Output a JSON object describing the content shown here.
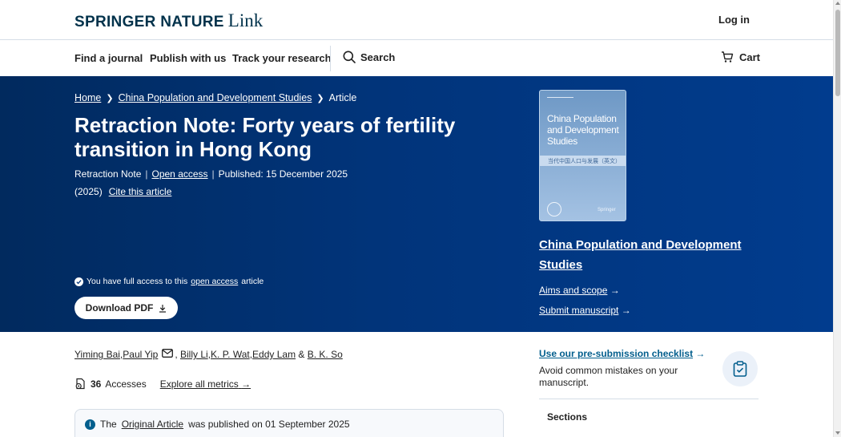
{
  "header": {
    "logo_brand": "SPRINGER NATURE",
    "logo_link": "Link",
    "login": "Log in"
  },
  "nav": {
    "find_journal": "Find a journal",
    "publish": "Publish with us",
    "track": "Track your research",
    "search": "Search",
    "cart": "Cart"
  },
  "breadcrumb": {
    "home": "Home",
    "journal": "China Population and Development Studies",
    "current": "Article"
  },
  "article": {
    "title": "Retraction Note: Forty years of fertility transition in Hong Kong",
    "type": "Retraction Note",
    "open_access": "Open access",
    "published": "Published: 15 December 2025",
    "year": "(2025)",
    "cite": "Cite this article",
    "access_prefix": "You have full access to this",
    "access_link": "open access",
    "access_suffix": "article",
    "download": "Download PDF"
  },
  "journal": {
    "cover_title": "China Population and Development Studies",
    "cover_chinese": "当代中国人口与发展（英文）",
    "cover_publisher": "Springer",
    "title": "China Population and Development Studies",
    "aims": "Aims and scope",
    "submit": "Submit manuscript"
  },
  "authors": [
    {
      "name": "Yiming Bai",
      "sep": ", "
    },
    {
      "name": "Paul Yip",
      "sep": ""
    },
    {
      "name": "Billy Li",
      "sep": ", "
    },
    {
      "name": "K. P. Wat",
      "sep": ", "
    },
    {
      "name": "Eddy Lam",
      "sep": " & "
    },
    {
      "name": "B. K. So",
      "sep": ""
    }
  ],
  "metrics": {
    "accesses": "36",
    "accesses_label": "Accesses",
    "explore": "Explore all metrics"
  },
  "notice": {
    "prefix": "The",
    "link": "Original Article",
    "suffix": "was published on 01 September 2025"
  },
  "sidebar": {
    "checklist_link": "Use our pre-submission checklist",
    "checklist_desc": "Avoid common mistakes on your manuscript.",
    "sections": "Sections"
  },
  "colors": {
    "hero_bg": "#01347a",
    "brand_blue": "#025e8d",
    "logo_navy": "#01324b"
  }
}
